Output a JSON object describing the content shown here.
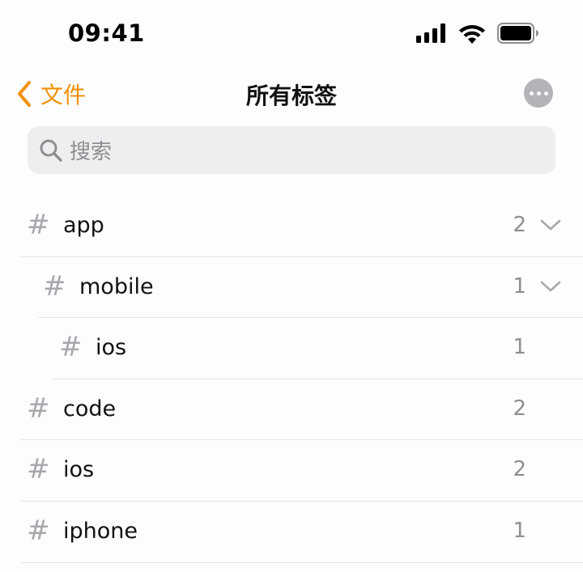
{
  "status_bar": {
    "time": "09:41"
  },
  "nav": {
    "back_label": "文件",
    "title": "所有标签",
    "more_icon": "ellipsis-circle-icon"
  },
  "search": {
    "placeholder": "搜索"
  },
  "colors": {
    "accent": "#f0900a",
    "secondary_text": "#8e8e93",
    "hash": "#a8a8ad",
    "search_bg": "#eeeef0"
  },
  "tags": [
    {
      "hash": "#",
      "name": "app",
      "count": "2",
      "expandable": true,
      "level": 0
    },
    {
      "hash": "#",
      "name": "mobile",
      "count": "1",
      "expandable": true,
      "level": 1
    },
    {
      "hash": "#",
      "name": "ios",
      "count": "1",
      "expandable": false,
      "level": 2
    },
    {
      "hash": "#",
      "name": "code",
      "count": "2",
      "expandable": false,
      "level": 0
    },
    {
      "hash": "#",
      "name": "ios",
      "count": "2",
      "expandable": false,
      "level": 0
    },
    {
      "hash": "#",
      "name": "iphone",
      "count": "1",
      "expandable": false,
      "level": 0
    }
  ]
}
